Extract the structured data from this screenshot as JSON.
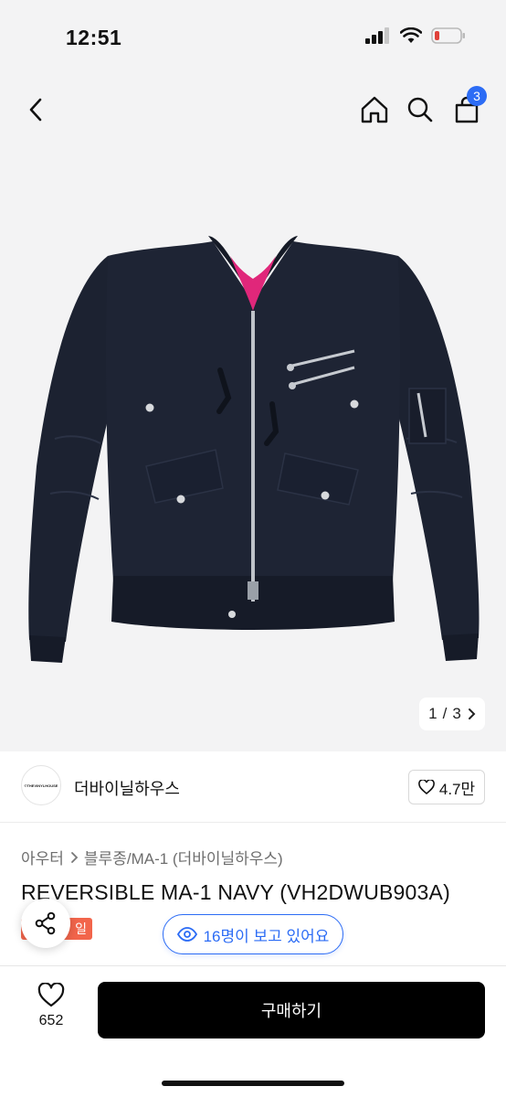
{
  "status_bar": {
    "time": "12:51"
  },
  "header": {
    "cart_count": "3"
  },
  "gallery": {
    "current": "1",
    "separator": "/",
    "total": "3"
  },
  "brand": {
    "logo_text": "©THEVINYLHOUSE",
    "name": "더바이닐하우스",
    "likes": "4.7만"
  },
  "product": {
    "breadcrumb": [
      "아우터",
      "블루종/MA-1 (더바이닐하우스)"
    ],
    "title": "REVERSIBLE MA-1 NAVY (VH2DWUB903A)",
    "badge_text": "일",
    "viewers_text": "16명이 보고 있어요"
  },
  "bottom": {
    "wish_count": "652",
    "buy_label": "구매하기"
  },
  "colors": {
    "accent": "#2c6cf5",
    "sale": "#f2654b",
    "buy_button": "#000000",
    "jacket": "#1b2130",
    "lining": "#e0277a"
  }
}
